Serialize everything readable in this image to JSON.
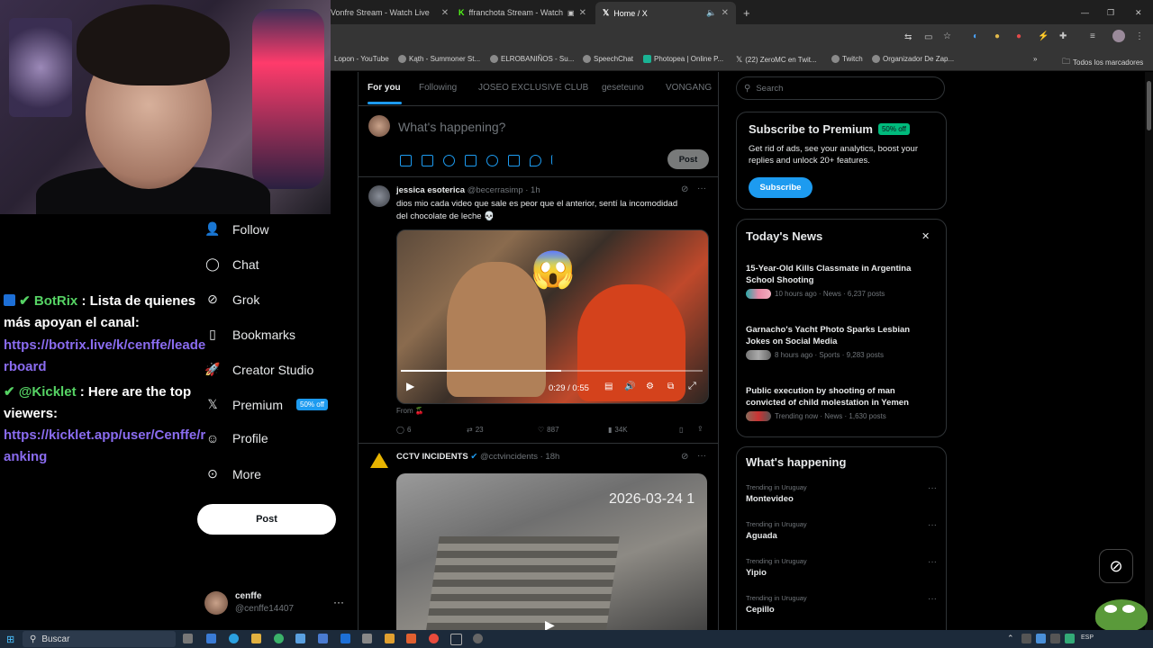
{
  "browser": {
    "tabs": [
      {
        "label": "Vonfre Stream - Watch Live"
      },
      {
        "label": "ffranchota Stream - Watch"
      },
      {
        "label": "Home / X",
        "active": true
      }
    ],
    "bookmarks": [
      "Lopon - YouTube",
      "Kąth - Summoner St...",
      "ELROBANIÑOS - Su...",
      "SpeechChat",
      "Photopea | Online P...",
      "(22) ZeroMC en Twit...",
      "Twitch",
      "Organizador De Zap...",
      "Todos los marcadores"
    ]
  },
  "nav": {
    "items": [
      {
        "label": "Follow",
        "icon": "person-plus-icon"
      },
      {
        "label": "Chat",
        "icon": "chat-bubble-icon"
      },
      {
        "label": "Grok",
        "icon": "grok-icon"
      },
      {
        "label": "Bookmarks",
        "icon": "bookmark-icon"
      },
      {
        "label": "Creator Studio",
        "icon": "rocket-icon"
      },
      {
        "label": "Premium",
        "icon": "x-logo-icon",
        "badge": "50% off"
      },
      {
        "label": "Profile",
        "icon": "profile-icon"
      },
      {
        "label": "More",
        "icon": "more-circle-icon"
      }
    ],
    "post_label": "Post",
    "account": {
      "name": "cenffe",
      "handle": "@cenffe14407"
    }
  },
  "chat_overlay": {
    "msg1_name": "BotRix",
    "msg1_text": ": Lista de quienes más apoyan el canal:",
    "msg1_link_a": "https://botrix.live/k/cenffe/leade",
    "msg1_link_b": "rboard",
    "msg2_name": "@Kicklet",
    "msg2_text": ": Here are the top viewers:",
    "msg2_link_a": "https://kicklet.app/user/Cenffe/r",
    "msg2_link_b": "anking"
  },
  "feed": {
    "tabs": [
      "For you",
      "Following",
      "JOSEO EXCLUSIVE CLUB",
      "geseteuno",
      "VONGANG"
    ],
    "composer_placeholder": "What's happening?",
    "composer_post": "Post",
    "tweet1": {
      "name": "jessica esoterica",
      "handle": "@becerrasimp · 1h",
      "text_line1": "dios mio cada video que sale es peor que el anterior, sentí la incomodidad",
      "text_line2": "del chocolate de leche 💀",
      "video_time": "0:29 / 0:55",
      "from": "From 🍒",
      "replies": "6",
      "reposts": "23",
      "likes": "887",
      "views": "34K"
    },
    "tweet2": {
      "name": "CCTV INCIDENTS",
      "handle": "@cctvincidents · 18h",
      "overlay_text": "2026-03-24 1"
    }
  },
  "sidebar": {
    "search_placeholder": "Search",
    "premium": {
      "title": "Subscribe to Premium",
      "badge": "50% off",
      "text": "Get rid of ads, see your analytics, boost your replies and unlock 20+ features.",
      "button": "Subscribe"
    },
    "news": {
      "title": "Today's News",
      "items": [
        {
          "headline": "15-Year-Old Kills Classmate in Argentina School Shooting",
          "meta": "10 hours ago · News · 6,237 posts"
        },
        {
          "headline": "Garnacho's Yacht Photo Sparks Lesbian Jokes on Social Media",
          "meta": "8 hours ago · Sports · 9,283 posts"
        },
        {
          "headline": "Public execution by shooting of man convicted of child molestation in Yemen",
          "meta": "Trending now · News · 1,630 posts"
        }
      ]
    },
    "happening": {
      "title": "What's happening",
      "items": [
        {
          "context": "Trending in Uruguay",
          "name": "Montevideo"
        },
        {
          "context": "Trending in Uruguay",
          "name": "Aguada"
        },
        {
          "context": "Trending in Uruguay",
          "name": "Yipio"
        },
        {
          "context": "Trending in Uruguay",
          "name": "Cepillo"
        }
      ]
    }
  },
  "taskbar": {
    "search": "Buscar",
    "lang": "ESP"
  },
  "colors": {
    "accent": "#1d9bf0",
    "premium_badge": "#00ba7c",
    "chat_link": "#8a6cf0"
  }
}
